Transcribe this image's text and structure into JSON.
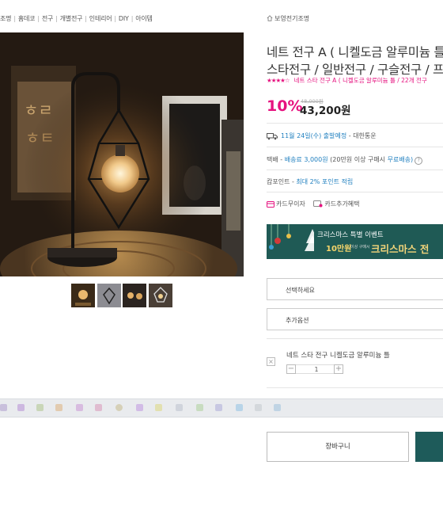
{
  "breadcrumb": [
    "조명",
    "홈데코",
    "전구",
    "개별전구",
    "인테리어",
    "DIY",
    "아이템"
  ],
  "brand": "보영전기조명",
  "product": {
    "title_line1": "네트 전구 A ( 니켈도금 알루미늄 틀 /",
    "title_line2": "스타전구 / 일반전구 / 구슬전구 / 프리",
    "stars": "★★★★☆",
    "rating_text": "네트 스타 전구 A ( 니켈도금 알루미늄 틀 / 22개 전구",
    "discount": "10%",
    "original_price": "48,000원",
    "price": "43,200원"
  },
  "shipping": {
    "date": "11월 24일(수) 출발예정",
    "carrier": "- 대한통운",
    "fee_label": "택배 -",
    "fee_value": "배송료 3,000원",
    "fee_cond": "(20만원 이상 구매시",
    "fee_free": "무료배송)"
  },
  "points": {
    "label": "캄포인트 -",
    "value": "최대 2% 포인트 적립"
  },
  "cards": {
    "interest_free": "카드무이자",
    "extra_benefit": "카드추가혜택"
  },
  "banner": {
    "line1": "크리스마스 특별 이벤트",
    "amount": "10만원",
    "cond": "이상 구매시",
    "big": "크리스마스 전"
  },
  "selects": {
    "option_placeholder": "선택하세요",
    "extra_option": "추가옵션"
  },
  "selected_option": {
    "name": "네트 스타 전구 니켈도금 알루미늄 틀",
    "remove": "×",
    "qty": "1",
    "minus": "−",
    "plus": "+"
  },
  "actions": {
    "cart": "장바구니"
  },
  "colors": {
    "accent_pink": "#e6127f",
    "link_blue": "#1f7fbf",
    "banner_teal": "#1f5a55",
    "buy_button": "#1e5b5a"
  }
}
